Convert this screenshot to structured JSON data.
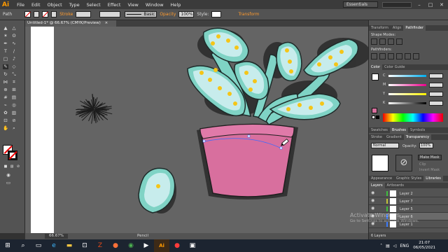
{
  "app": {
    "logo": "Ai"
  },
  "menubar": {
    "items": [
      "File",
      "Edit",
      "Object",
      "Type",
      "Select",
      "Effect",
      "View",
      "Window",
      "Help"
    ],
    "workspace": "Essentials",
    "win_min": "–",
    "win_max": "□",
    "win_close": "✕"
  },
  "controlbar": {
    "selection": "Path",
    "stroke_label": "Stroke",
    "brush_label": "Basic",
    "opacity_label": "Opacity",
    "opacity_value": "100%",
    "style_label": "Style:",
    "transform_label": "Transform"
  },
  "document": {
    "tab": "Untitled-1* @ 66.67% (CMYK/Preview)",
    "tab_close": "×"
  },
  "status": {
    "zoom": "66.67%",
    "tool": "Pencil"
  },
  "panels": {
    "top_tabs": [
      "Transform",
      "Align",
      "Pathfinder"
    ],
    "shape_modes": "Shape Modes:",
    "pathfinders": "Pathfinders:",
    "color_tabs": [
      "Color",
      "Color Guide"
    ],
    "color_channels": [
      "C",
      "M",
      "Y",
      "K"
    ],
    "swatch_tabs": [
      "Swatches",
      "Brushes",
      "Symbols"
    ],
    "stroke_tabs": [
      "Stroke",
      "Gradient",
      "Transparency"
    ],
    "blend_mode": "Normal",
    "opacity_label": "Opacity:",
    "opacity_value": "100%",
    "make_mask": "Make Mask",
    "clip": "Clip",
    "invert_mask": "Invert Mask",
    "bottom_tabs": [
      "Appearance",
      "Graphic Styles",
      "Libraries"
    ],
    "layer_tabs": [
      "Layers",
      "Artboards"
    ],
    "layers": [
      "Layer 2",
      "Layer 7",
      "Layer 5",
      "Layer 6",
      "Layer 1"
    ],
    "layer_count": "6 Layers"
  },
  "watermark": {
    "line1": "Activate Windows",
    "line2": "Go to Settings to activate Windows."
  },
  "taskbar": {
    "time": "21:07",
    "date": "06/05/2021",
    "lang": "ENG"
  },
  "colors": {
    "canvas": "#646464",
    "pot": "#d86f9e",
    "pot_rim": "#e07aa9",
    "leaf_outer": "#7fd3c5",
    "leaf_inner": "#c7ecec",
    "dot": "#f5c518",
    "accent": "#ff9a00"
  }
}
